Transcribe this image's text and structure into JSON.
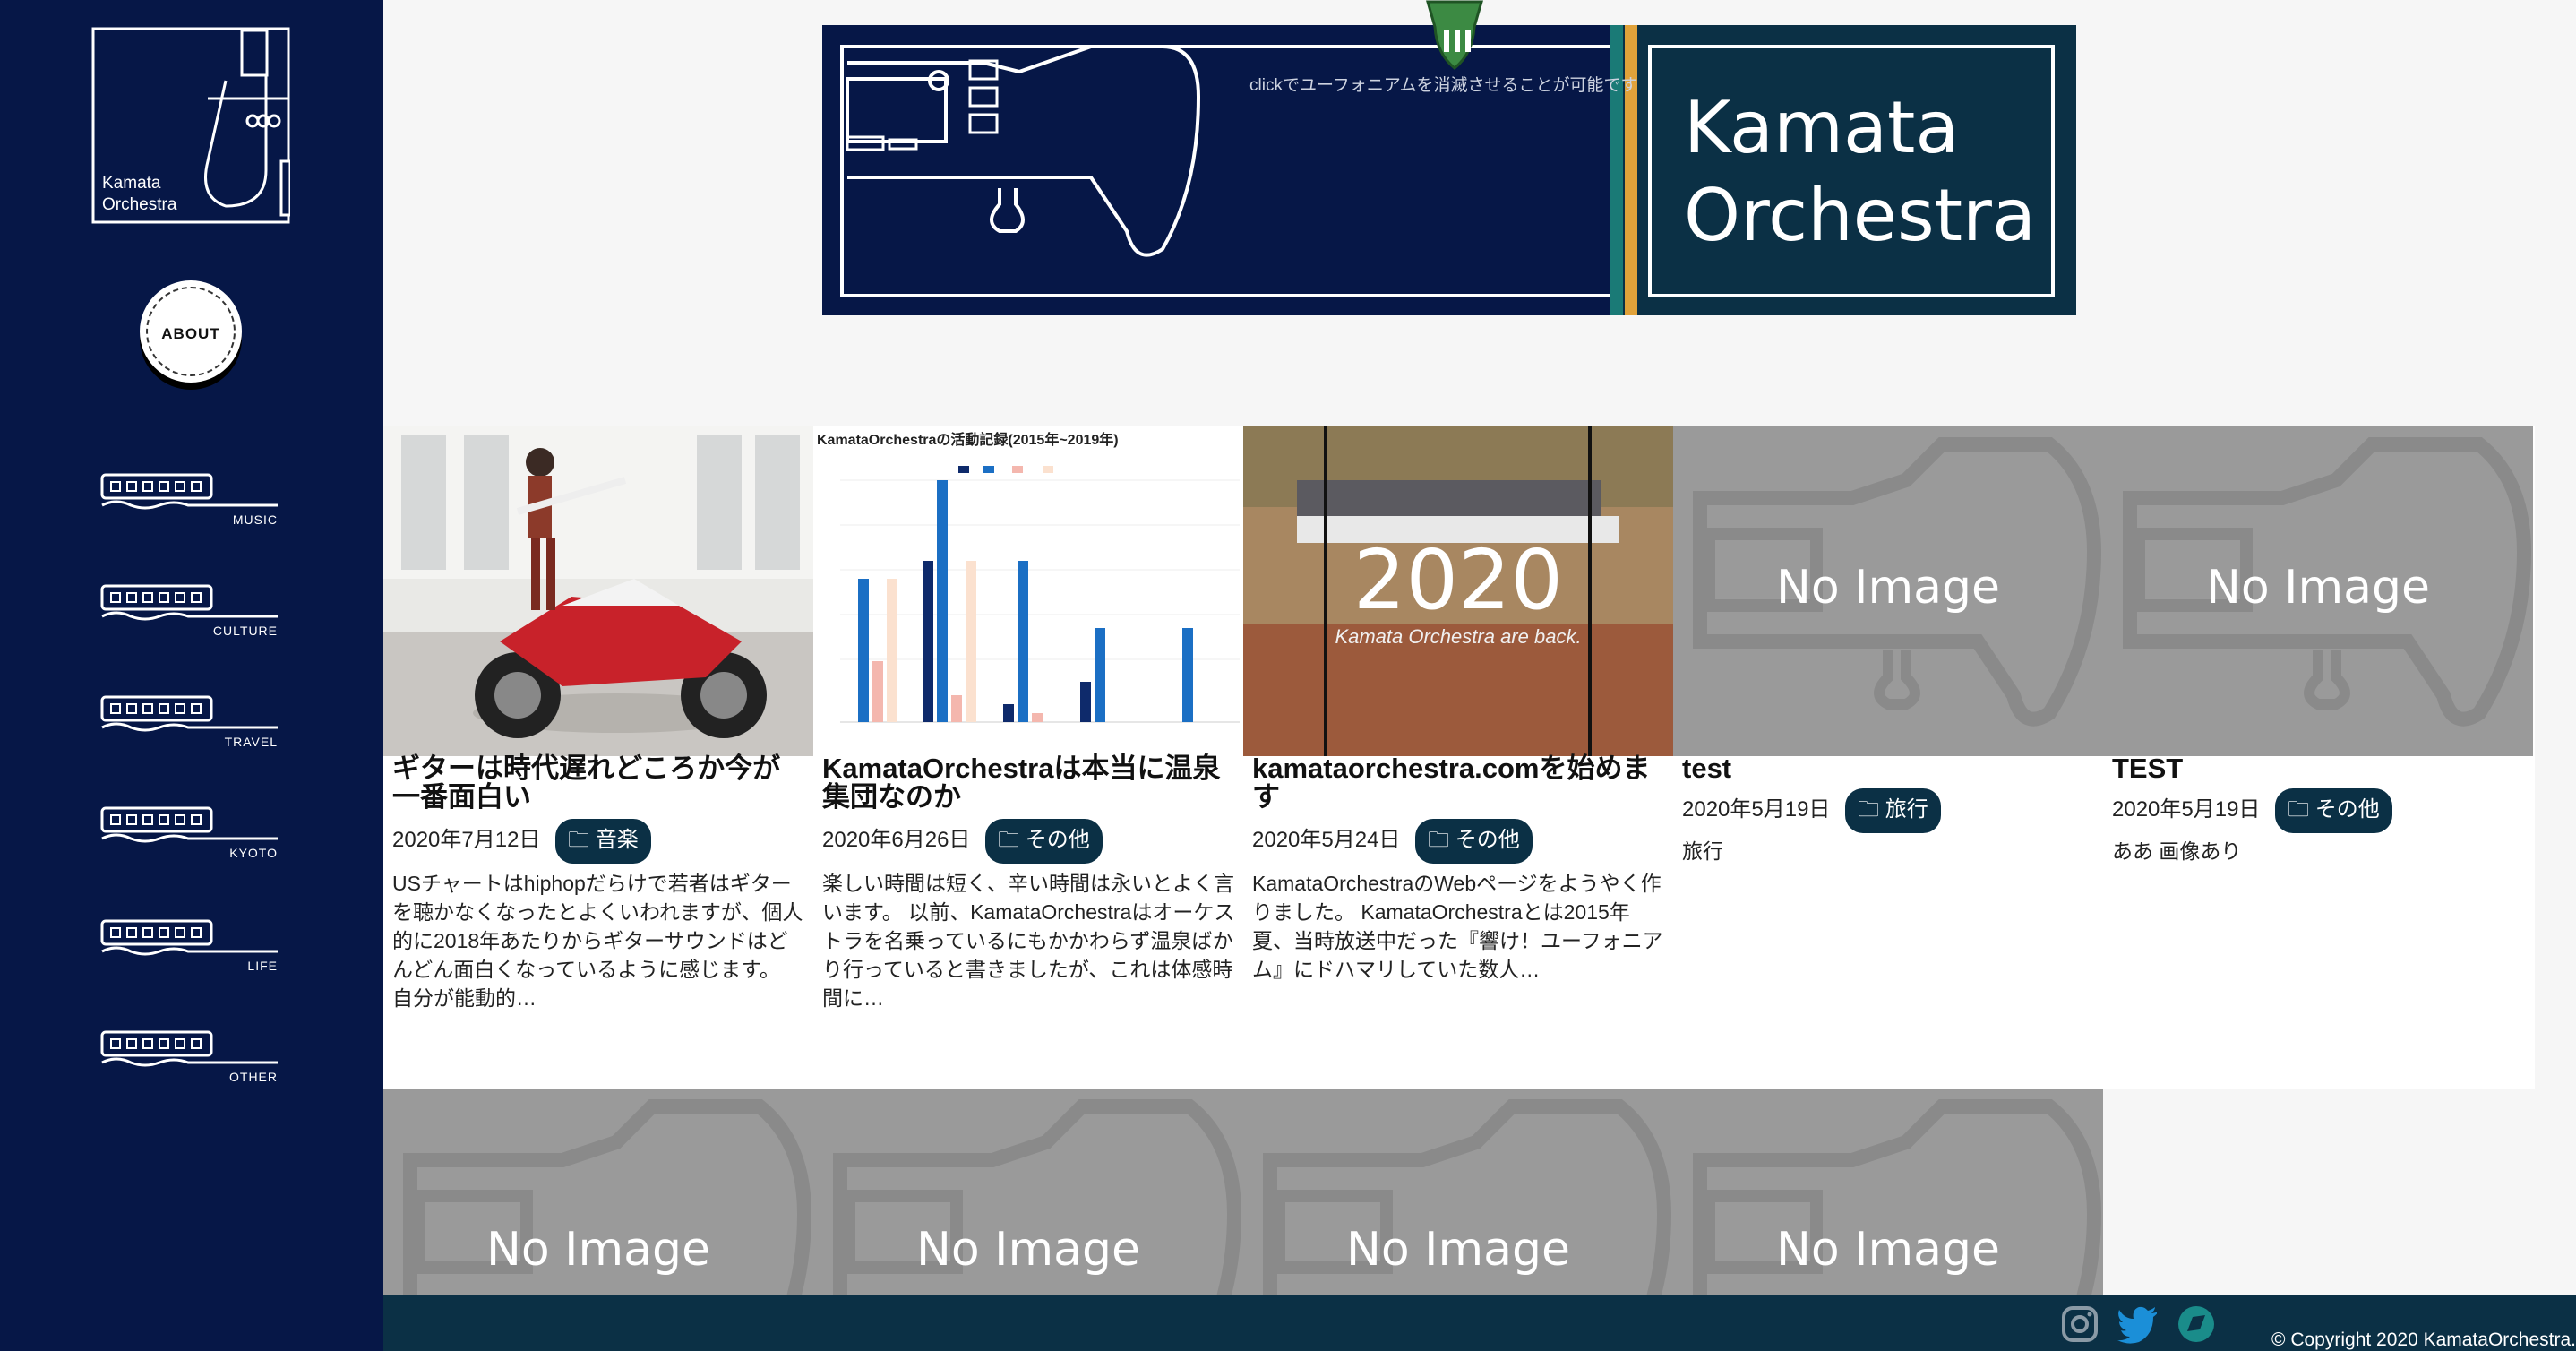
{
  "logo": {
    "line1": "Kamata",
    "line2": "Orchestra"
  },
  "about_label": "ABOUT",
  "nav": [
    {
      "label": "MUSIC"
    },
    {
      "label": "CULTURE"
    },
    {
      "label": "TRAVEL"
    },
    {
      "label": "KYOTO"
    },
    {
      "label": "LIFE"
    },
    {
      "label": "OTHER"
    }
  ],
  "banner": {
    "hint": "clickでユーフォニアムを消滅させることが可能です",
    "title_line1": "Kamata",
    "title_line2": "Orchestra"
  },
  "posts": [
    {
      "title": "ギターは時代遅れどころか今が一番面白い",
      "date": "2020年7月12日",
      "category": "音楽",
      "excerpt": "USチャートはhiphopだらけで若者はギターを聴かなくなったとよくいわれますが、個人的に2018年あたりからギターサウンドはどんどん面白くなっているように感じます。 自分が能動的…"
    },
    {
      "title": "KamataOrchestraは本当に温泉集団なのか",
      "date": "2020年6月26日",
      "category": "その他",
      "excerpt": "楽しい時間は短く、辛い時間は永いとよく言います。 以前、KamataOrchestraはオーケストラを名乗っているにもかかわらず温泉ばかり行っていると書きましたが、これは体感時間に…",
      "chart_title": "KamataOrchestraの活動記録(2015年~2019年)"
    },
    {
      "title": "kamataorchestra.comを始めます",
      "date": "2020年5月24日",
      "category": "その他",
      "excerpt": "KamataOrchestraのWebページをようやく作りました。 KamataOrchestraとは2015年夏、当時放送中だった『響け！ユーフォニアム』にドハマリしていた数人…",
      "thumb_big": "2020",
      "thumb_small": "Kamata Orchestra are back."
    },
    {
      "title": "test",
      "date": "2020年5月19日",
      "category": "旅行",
      "excerpt": "旅行",
      "thumb": "No Image"
    },
    {
      "title": "TEST",
      "date": "2020年5月19日",
      "category": "その他",
      "excerpt": "ああ 画像あり",
      "thumb": "No Image"
    }
  ],
  "more_posts": [
    {
      "thumb": "No Image"
    },
    {
      "thumb": "No Image"
    },
    {
      "thumb": "No Image"
    },
    {
      "thumb": "No Image"
    }
  ],
  "footer": {
    "copyright": "© Copyright 2020 KamataOrchestra."
  }
}
